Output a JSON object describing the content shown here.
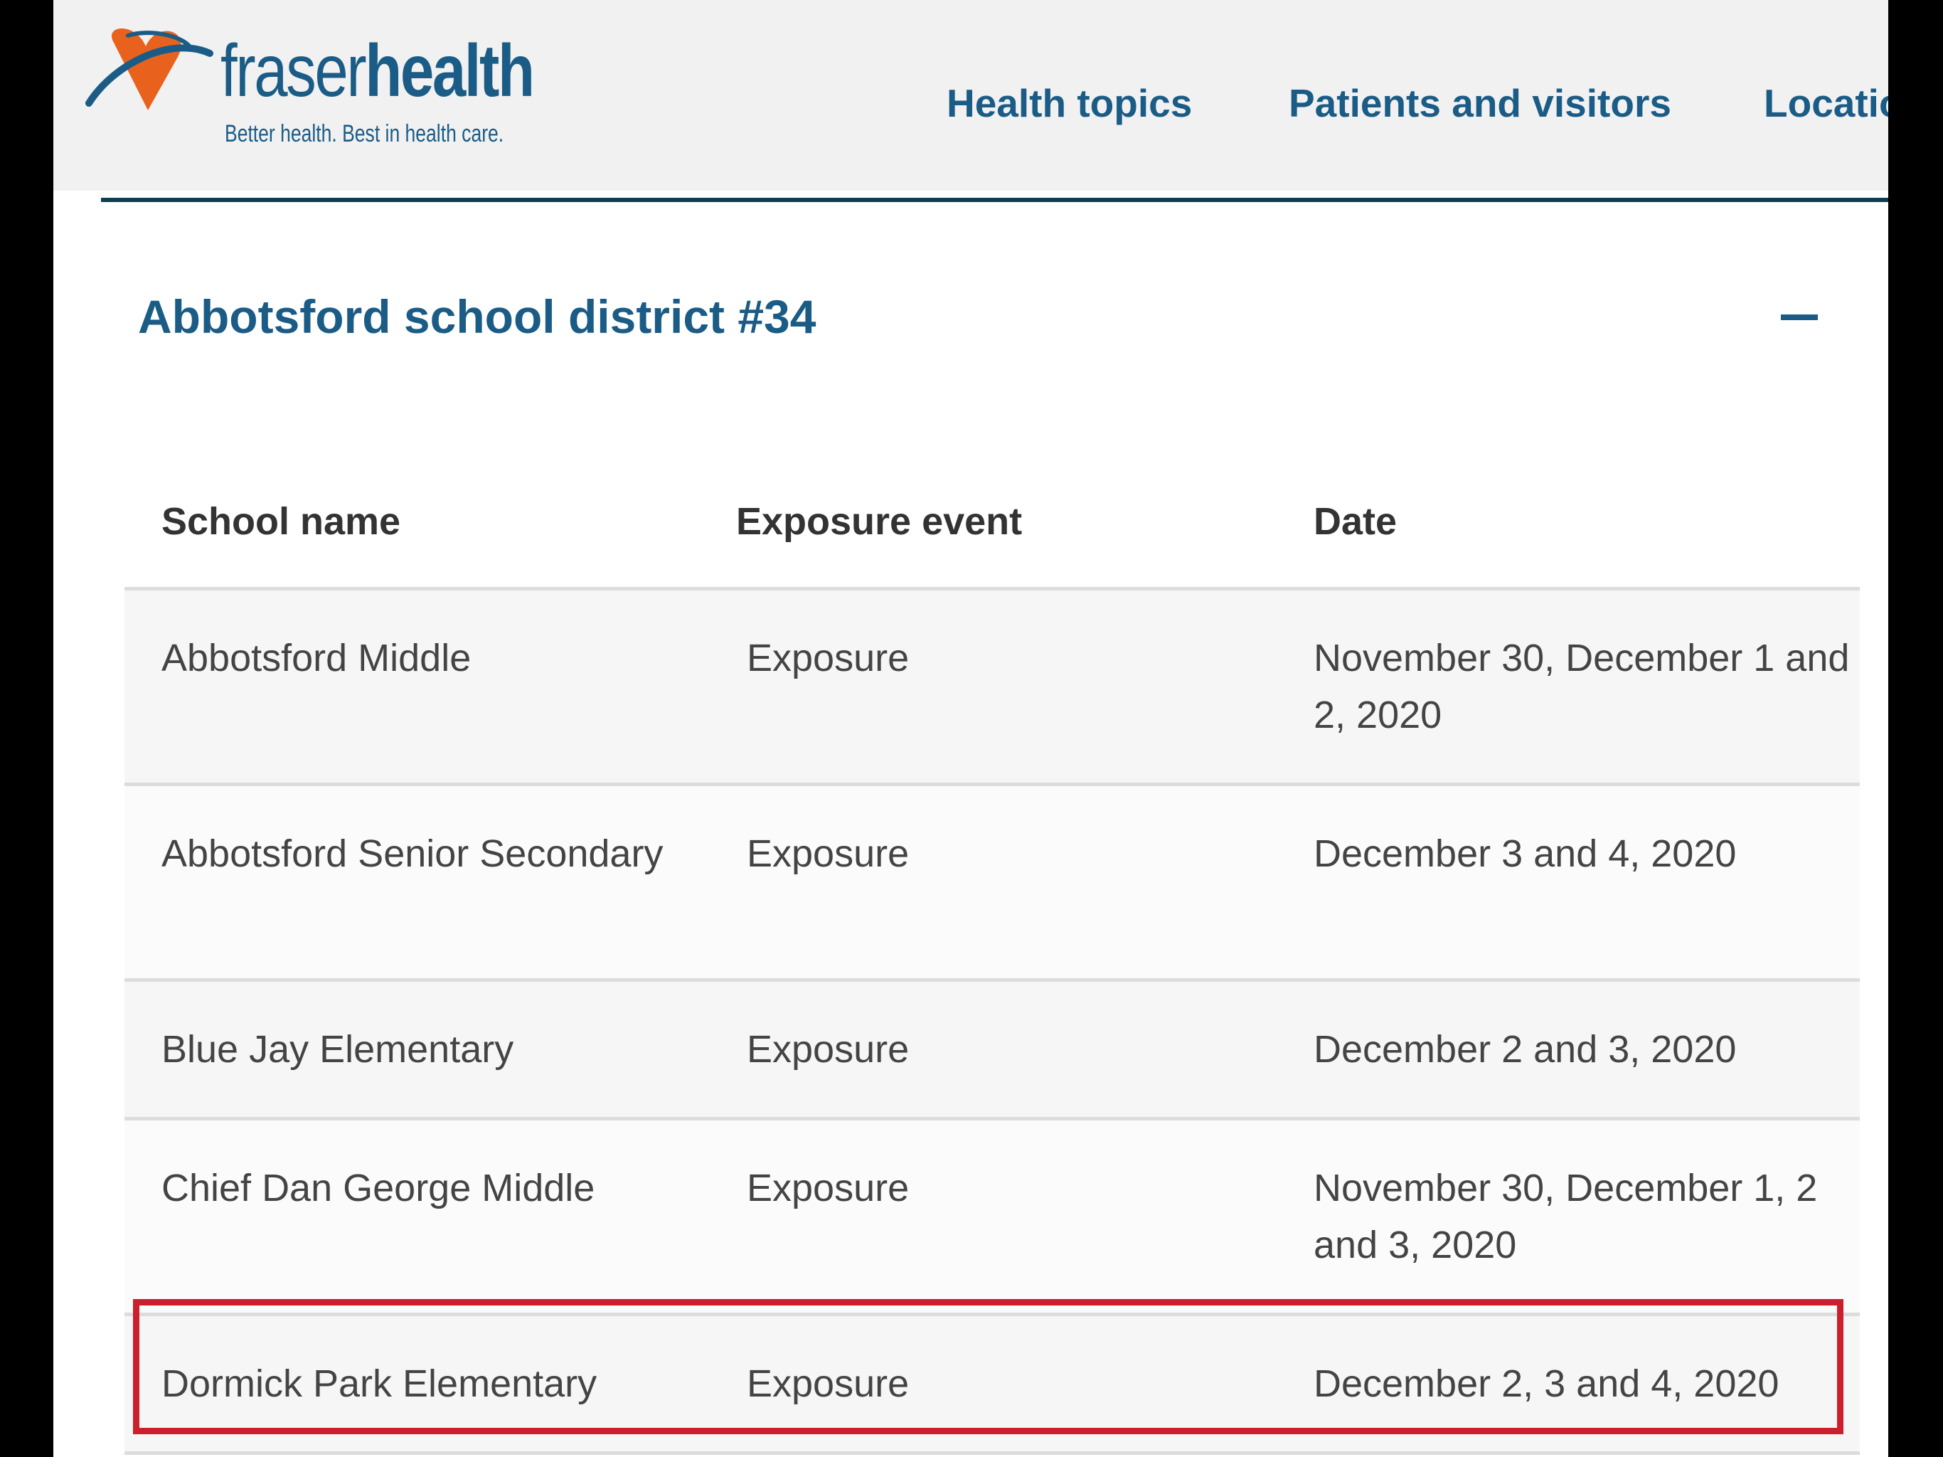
{
  "header": {
    "logo": {
      "word_light": "fraser",
      "word_bold": "health",
      "tagline": "Better health. Best in health care."
    },
    "nav": [
      {
        "label": "Health topics"
      },
      {
        "label": "Patients and visitors"
      },
      {
        "label": "Locatio"
      }
    ]
  },
  "accordion": {
    "title": "Abbotsford school district #34",
    "toggle_icon": "minus-icon"
  },
  "table": {
    "headers": [
      "School name",
      "Exposure event",
      "Date"
    ],
    "rows": [
      {
        "school": "Abbotsford Middle",
        "event": "Exposure",
        "date": "November 30, December 1 and 2, 2020"
      },
      {
        "school": "Abbotsford Senior Secondary",
        "event": "Exposure",
        "date": "December 3 and 4, 2020"
      },
      {
        "school": "Blue Jay Elementary",
        "event": "Exposure",
        "date": "December 2 and 3, 2020"
      },
      {
        "school": "Chief Dan George Middle",
        "event": "Exposure",
        "date": "November 30, December 1, 2 and 3, 2020"
      },
      {
        "school": "Dormick Park Elementary",
        "event": "Exposure",
        "date": "December 2, 3 and 4, 2020"
      }
    ]
  },
  "colors": {
    "brand_blue": "#1a5c86",
    "brand_orange": "#e8621e",
    "highlight_red": "#cc1f2d"
  }
}
